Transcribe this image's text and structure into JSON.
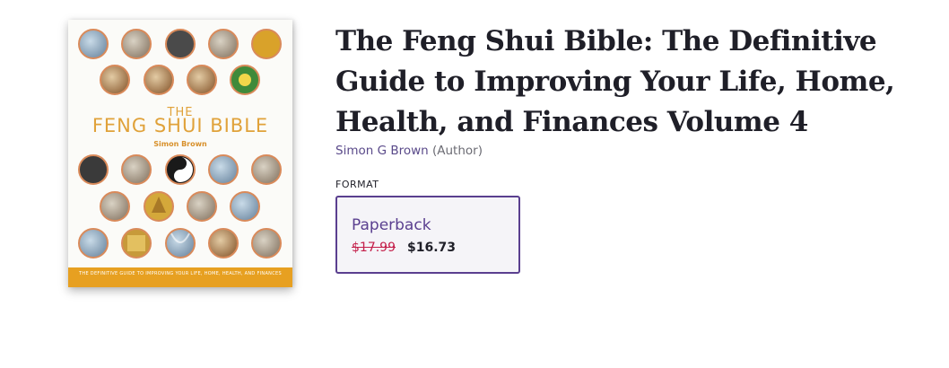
{
  "product": {
    "title": "The Feng Shui Bible: The Definitive Guide to Improving Your Life, Home, Health, and Finances Volume 4",
    "author_name": "Simon G Brown",
    "author_role": "(Author)"
  },
  "cover": {
    "title_small": "THE",
    "title": "FENG SHUI BIBLE",
    "author": "Simon Brown",
    "tagline": "THE DEFINITIVE GUIDE TO IMPROVING YOUR LIFE, HOME, HEALTH, AND FINANCES",
    "colors": {
      "title": "#e0a23a",
      "strip": "#e7a021",
      "circle_border": "#d98a5a"
    }
  },
  "format": {
    "label": "FORMAT",
    "options": [
      {
        "name": "Paperback",
        "list_price": "$17.99",
        "sale_price": "$16.73",
        "selected": true
      }
    ]
  },
  "colors": {
    "accent": "#5a3f8f",
    "strike_price": "#c4204b"
  }
}
